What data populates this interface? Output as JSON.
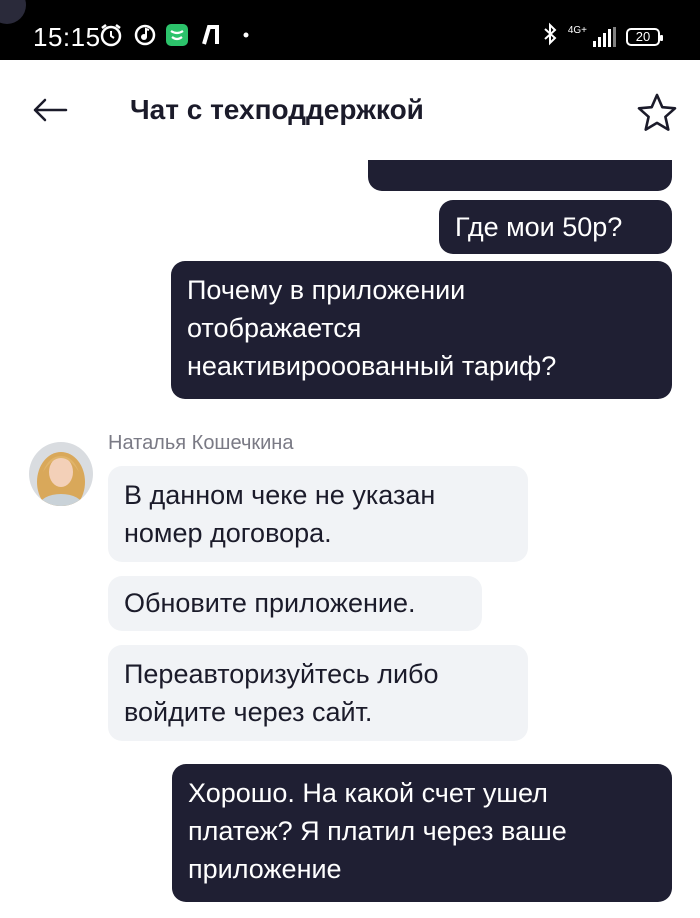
{
  "status_bar": {
    "time": "15:15",
    "network": "4G+",
    "battery": "20",
    "icons": [
      "alarm-icon",
      "music-icon",
      "app-icon",
      "nfc-icon",
      "bluetooth-icon",
      "signal-icon"
    ]
  },
  "header": {
    "title": "Чат с техподдержкой",
    "back_icon": "arrow-left-icon",
    "favorite_icon": "star-icon"
  },
  "messages": [
    {
      "direction": "out",
      "text": ""
    },
    {
      "direction": "out",
      "text": "Где мои 50р?"
    },
    {
      "direction": "out",
      "lines": [
        "Почему в приложении",
        "отображается",
        "неактивирооованный тариф?"
      ]
    },
    {
      "direction": "in",
      "sender": "Наталья Кошечкина",
      "lines": [
        "В данном чеке не указан",
        "номер договора."
      ]
    },
    {
      "direction": "in",
      "text": "Обновите приложение."
    },
    {
      "direction": "in",
      "lines": [
        "Переавторизуйтесь либо",
        "войдите через сайт."
      ]
    },
    {
      "direction": "out",
      "lines": [
        "Хорошо. На какой счет ушел",
        "платеж? Я платил через ваше",
        "приложение"
      ]
    }
  ],
  "colors": {
    "outgoing_bubble": "#1f1f33",
    "incoming_bubble": "#f1f3f6",
    "status_bar": "#000000"
  }
}
